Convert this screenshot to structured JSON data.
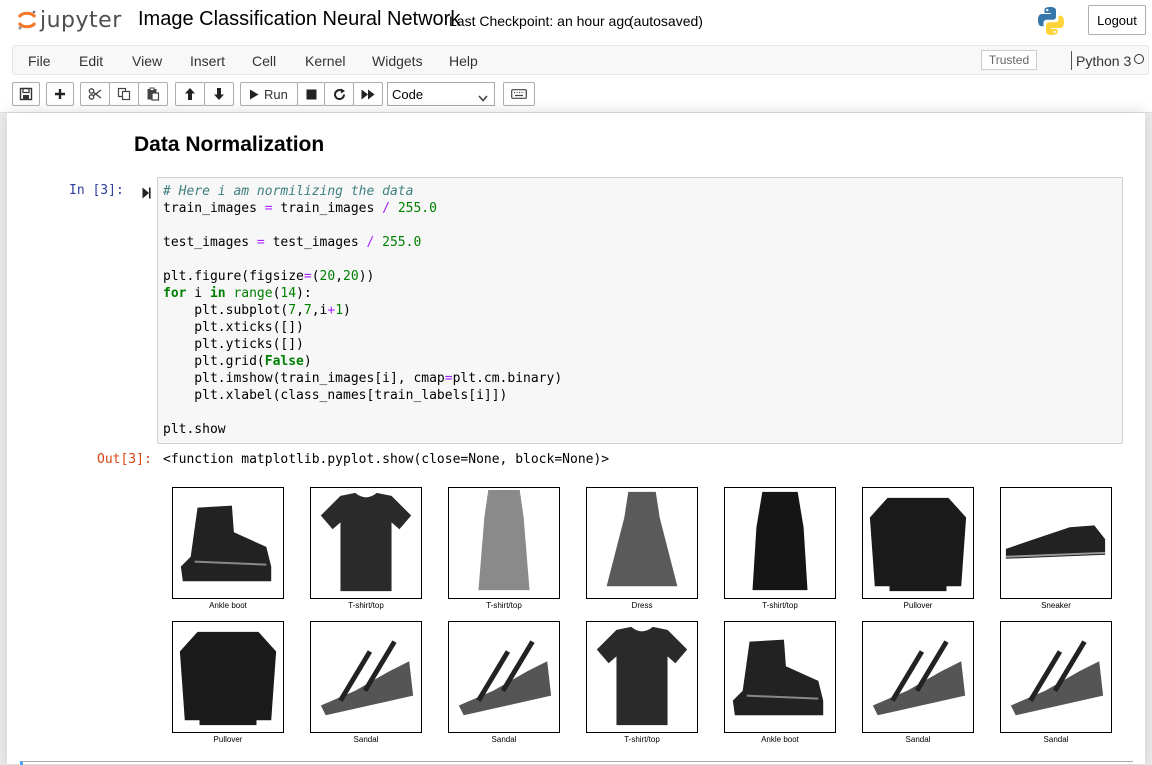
{
  "header": {
    "logo_text": "jupyter",
    "notebook_title": "Image Classification Neural Network",
    "checkpoint": "Last Checkpoint: an hour ago",
    "autosave_status": "(autosaved)",
    "logout_label": "Logout"
  },
  "menubar": {
    "items": [
      "File",
      "Edit",
      "View",
      "Insert",
      "Cell",
      "Kernel",
      "Widgets",
      "Help"
    ],
    "trusted_label": "Trusted",
    "kernel_name": "Python 3"
  },
  "toolbar": {
    "run_label": "Run",
    "cell_type": "Code",
    "icons": [
      "save-icon",
      "plus-icon",
      "cut-icon",
      "copy-icon",
      "paste-icon",
      "arrow-up-icon",
      "arrow-down-icon",
      "play-icon",
      "stop-icon",
      "restart-icon",
      "fast-forward-icon",
      "keyboard-icon"
    ]
  },
  "notebook": {
    "markdown_heading": "Data Normalization",
    "input_prompt": "In [3]:",
    "code_lines": [
      "# Here i am normilizing the data",
      "train_images = train_images / 255.0",
      "",
      "test_images = test_images / 255.0",
      "",
      "plt.figure(figsize=(20,20))",
      "for i in range(14):",
      "    plt.subplot(7,7,i+1)",
      "    plt.xticks([])",
      "    plt.yticks([])",
      "    plt.grid(False)",
      "    plt.imshow(train_images[i], cmap=plt.cm.binary)",
      "    plt.xlabel(class_names[train_labels[i]])",
      "",
      "plt.show"
    ],
    "output_prompt": "Out[3]:",
    "output_text": "<function matplotlib.pyplot.show(close=None, block=None)>",
    "figure_labels": [
      "Ankle boot",
      "T-shirt/top",
      "T-shirt/top",
      "Dress",
      "T-shirt/top",
      "Pullover",
      "Sneaker",
      "Pullover",
      "Sandal",
      "Sandal",
      "T-shirt/top",
      "Ankle boot",
      "Sandal",
      "Sandal"
    ]
  },
  "colors": {
    "in_prompt": "#303f9f",
    "out_prompt": "#d84315",
    "selected_cell_border": "#42a5f5"
  }
}
